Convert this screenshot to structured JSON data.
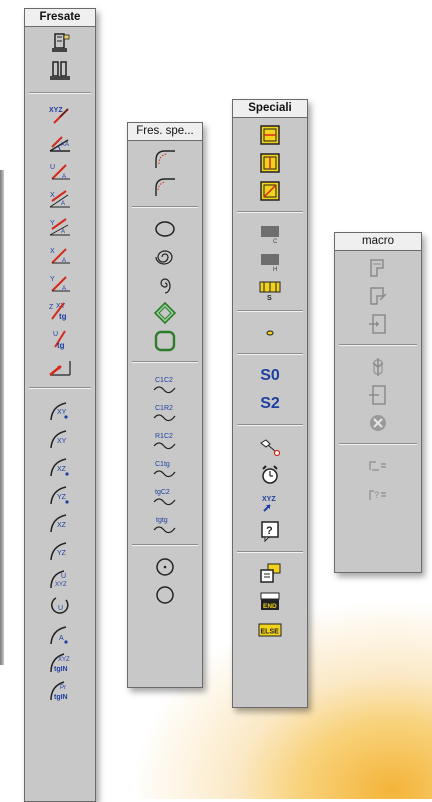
{
  "palettes": {
    "fresate": {
      "title": "Fresate"
    },
    "fres_spe": {
      "title": "Fres. spe..."
    },
    "speciali": {
      "title": "Speciali",
      "s0_label": "S0",
      "s2_label": "S2",
      "else_label": "ELSE",
      "end_label": "END"
    },
    "macro": {
      "title": "macro"
    }
  },
  "colors": {
    "panel": "#c8c8c8",
    "accent_blue": "#1f3fa0",
    "accent_red": "#d42a1c",
    "accent_yellow": "#f2d21a",
    "accent_green": "#3ea13e"
  }
}
